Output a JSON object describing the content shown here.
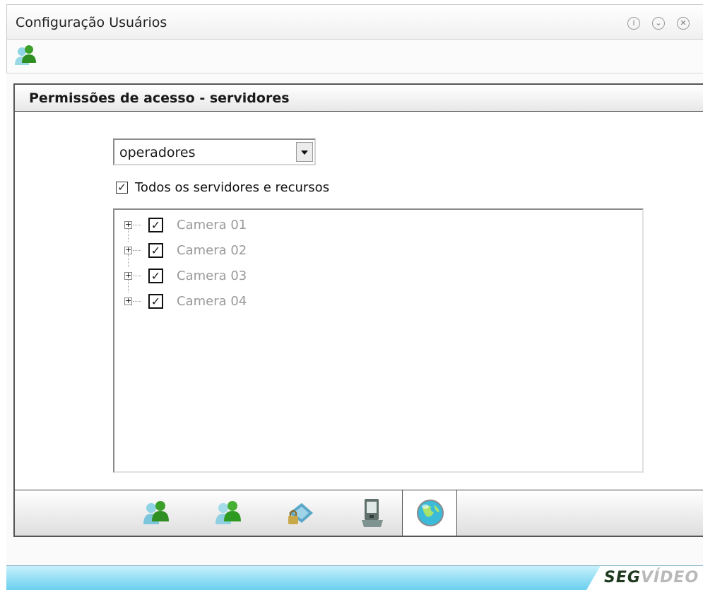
{
  "window": {
    "title": "Configuração Usuários",
    "controls": [
      "info-icon",
      "minimize-icon",
      "close-icon"
    ]
  },
  "toolbar": {
    "icon": "users-icon"
  },
  "panel": {
    "title": "Permissões de acesso - servidores",
    "group_select": {
      "value": "operadores"
    },
    "all_checkbox": {
      "checked": true,
      "label": "Todos os servidores e recursos"
    },
    "tree": [
      {
        "label": "Camera 01",
        "checked": true
      },
      {
        "label": "Camera 02",
        "checked": true
      },
      {
        "label": "Camera 03",
        "checked": true
      },
      {
        "label": "Camera 04",
        "checked": true
      }
    ]
  },
  "tabs": [
    {
      "icon": "users-blue-icon",
      "active": false
    },
    {
      "icon": "users-green-icon",
      "active": false
    },
    {
      "icon": "lock-network-icon",
      "active": false
    },
    {
      "icon": "device-icon",
      "active": false
    },
    {
      "icon": "globe-icon",
      "active": true
    }
  ],
  "footer": {
    "brand_seg": "SEG",
    "brand_video": "VÍDEO"
  },
  "colors": {
    "footer_bar": "#6ad0ef",
    "brand_dark": "#1f3a1f",
    "label_gray": "#9a9a9a"
  }
}
